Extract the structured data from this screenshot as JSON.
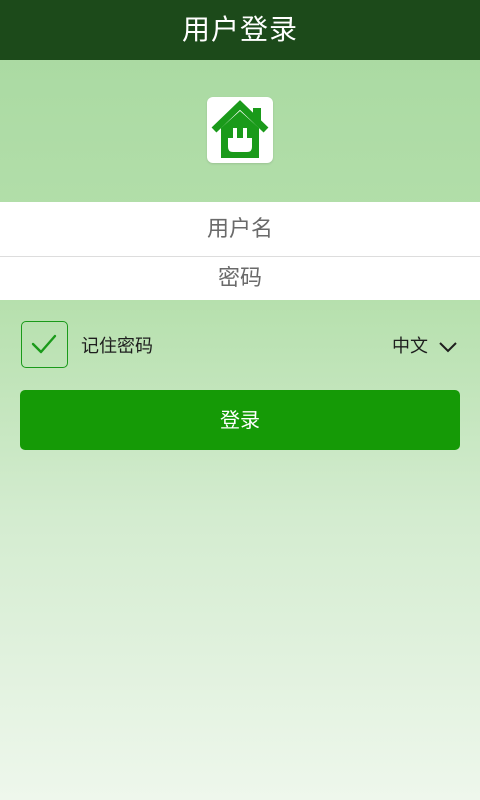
{
  "header": {
    "title": "用户登录"
  },
  "logo": {
    "icon": "house-plug-icon",
    "color": "#1a9a1a"
  },
  "form": {
    "username_placeholder": "用户名",
    "password_placeholder": "密码"
  },
  "options": {
    "remember_label": "记住密码",
    "remember_checked": true,
    "language": "中文"
  },
  "actions": {
    "login_label": "登录"
  },
  "colors": {
    "header_bg": "#1c4a1a",
    "accent": "#159a06",
    "checkbox_border": "#1a9a1a"
  }
}
